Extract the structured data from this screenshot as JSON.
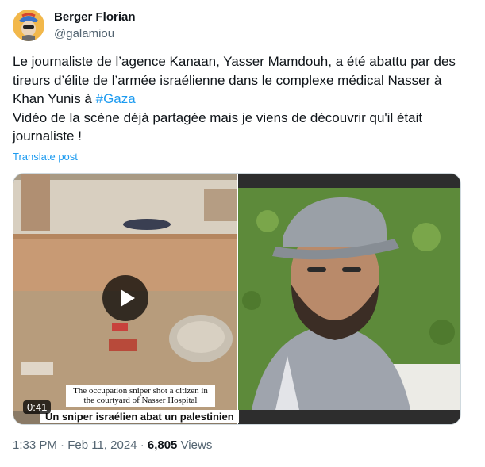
{
  "author": {
    "name": "Berger Florian",
    "handle": "@galamiou",
    "avatar_icon": "avatar-illustration"
  },
  "post": {
    "text_before_hashtag": "Le journaliste de l’agence Kanaan, Yasser Mamdouh, a été abattu par des tireurs d’élite de l’armée israélienne dans le complexe médical Nasser à Khan Yunis à ",
    "hashtag": "#Gaza",
    "text_second_line": "Vidéo de la scène déjà partagée mais je viens de découvrir qu'il était journaliste !",
    "translate_label": "Translate post"
  },
  "media": {
    "video_duration": "0:41",
    "video_caption": "The occupation sniper shot a citizen in the courtyard of Nasser Hospital",
    "video_banner": "Un sniper israélien abat un palestinien",
    "play_icon": "play-icon"
  },
  "meta": {
    "time": "1:33 PM",
    "separator": "·",
    "date": "Feb 11, 2024",
    "views_count": "6,805",
    "views_label": "Views"
  },
  "colors": {
    "link": "#1d9bf0",
    "secondary_text": "#536471",
    "primary_text": "#0f1419"
  }
}
